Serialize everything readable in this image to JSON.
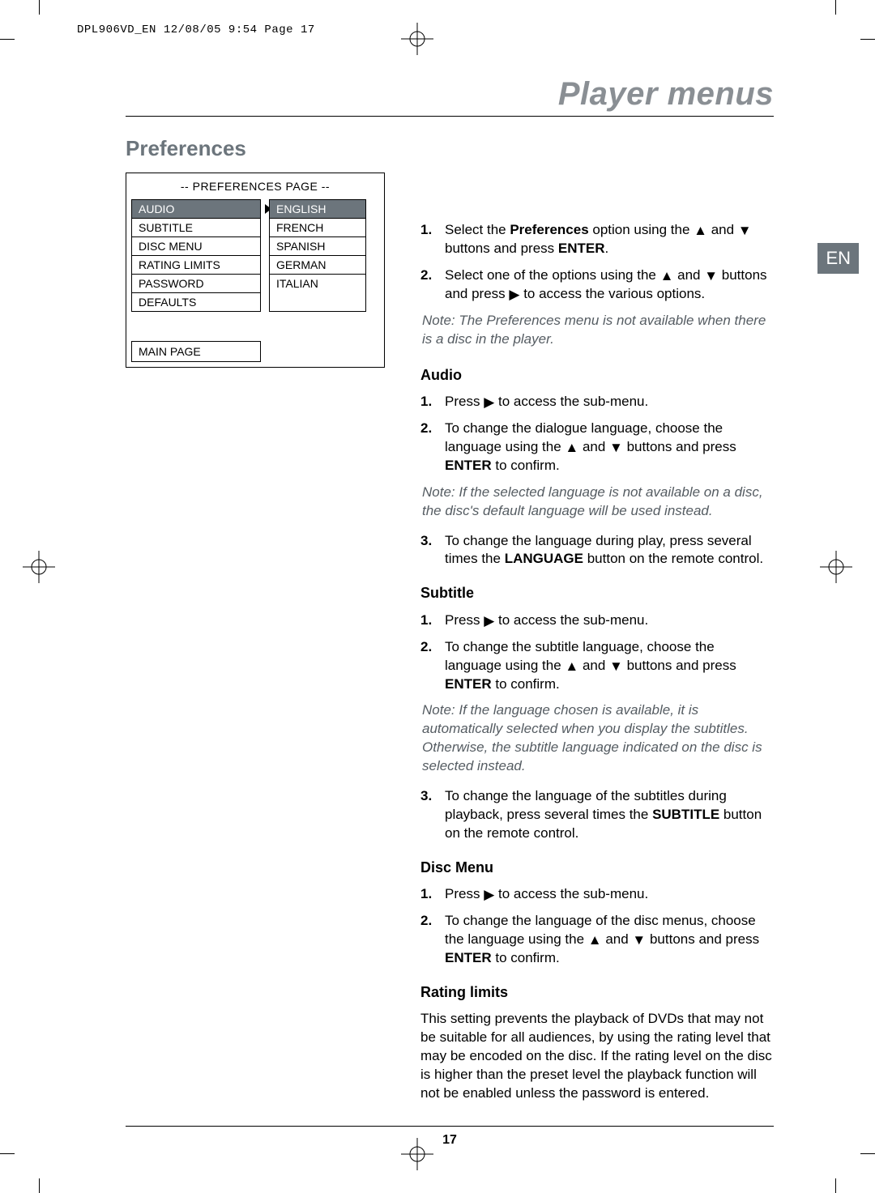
{
  "slug": "DPL906VD_EN  12/08/05  9:54  Page 17",
  "lang_tab": "EN",
  "chapter_title": "Player menus",
  "section_title": "Preferences",
  "page_number": "17",
  "osd": {
    "title": "-- PREFERENCES PAGE --",
    "menu": [
      "AUDIO",
      "SUBTITLE",
      "DISC MENU",
      "RATING LIMITS",
      "PASSWORD",
      "DEFAULTS"
    ],
    "submenu": [
      "ENGLISH",
      "FRENCH",
      "SPANISH",
      "GERMAN",
      "ITALIAN"
    ],
    "main_page": "MAIN PAGE"
  },
  "intro": {
    "s1_a": "Select the ",
    "s1_b": "Preferences",
    "s1_c": " option using the ",
    "s1_d": " and ",
    "s1_e": " buttons and press ",
    "s1_f": "ENTER",
    "s1_g": ".",
    "s2_a": "Select one of the options using the ",
    "s2_b": " and ",
    "s2_c": " buttons and press ",
    "s2_d": " to access the various options.",
    "note": "Note: The Preferences menu is not available when there is a disc in the player."
  },
  "audio": {
    "heading": "Audio",
    "s1_a": "Press ",
    "s1_b": " to access the sub-menu.",
    "s2_a": "To change the dialogue language, choose the language using the ",
    "s2_b": " and ",
    "s2_c": " buttons and press ",
    "s2_d": "ENTER",
    "s2_e": " to confirm.",
    "note": "Note: If the selected language is not available on a disc, the disc's default language will be used instead.",
    "s3_a": "To change the language during play, press several times the ",
    "s3_b": "LANGUAGE",
    "s3_c": " button on the remote control."
  },
  "subtitle": {
    "heading": "Subtitle",
    "s1_a": "Press ",
    "s1_b": " to access the sub-menu.",
    "s2_a": "To change the subtitle language, choose the language using the ",
    "s2_b": " and ",
    "s2_c": " buttons and press ",
    "s2_d": "ENTER",
    "s2_e": " to confirm.",
    "note": "Note: If the language chosen is available, it is automatically selected when you display the subtitles. Otherwise, the subtitle language indicated on the disc is selected instead.",
    "s3_a": "To change the language of the subtitles during playback, press several times the ",
    "s3_b": "SUBTITLE",
    "s3_c": " button on the remote control."
  },
  "discmenu": {
    "heading": "Disc Menu",
    "s1_a": "Press ",
    "s1_b": " to access the sub-menu.",
    "s2_a": "To change the language of the disc menus, choose the language using the ",
    "s2_b": " and ",
    "s2_c": " buttons and press ",
    "s2_d": "ENTER",
    "s2_e": " to confirm."
  },
  "rating": {
    "heading": "Rating limits",
    "para": "This setting prevents the playback of DVDs that may not be suitable for all audiences, by using the rating level that may be encoded on the disc. If the rating level on the disc is higher than the preset level the playback function will not be enabled unless the password is entered."
  }
}
